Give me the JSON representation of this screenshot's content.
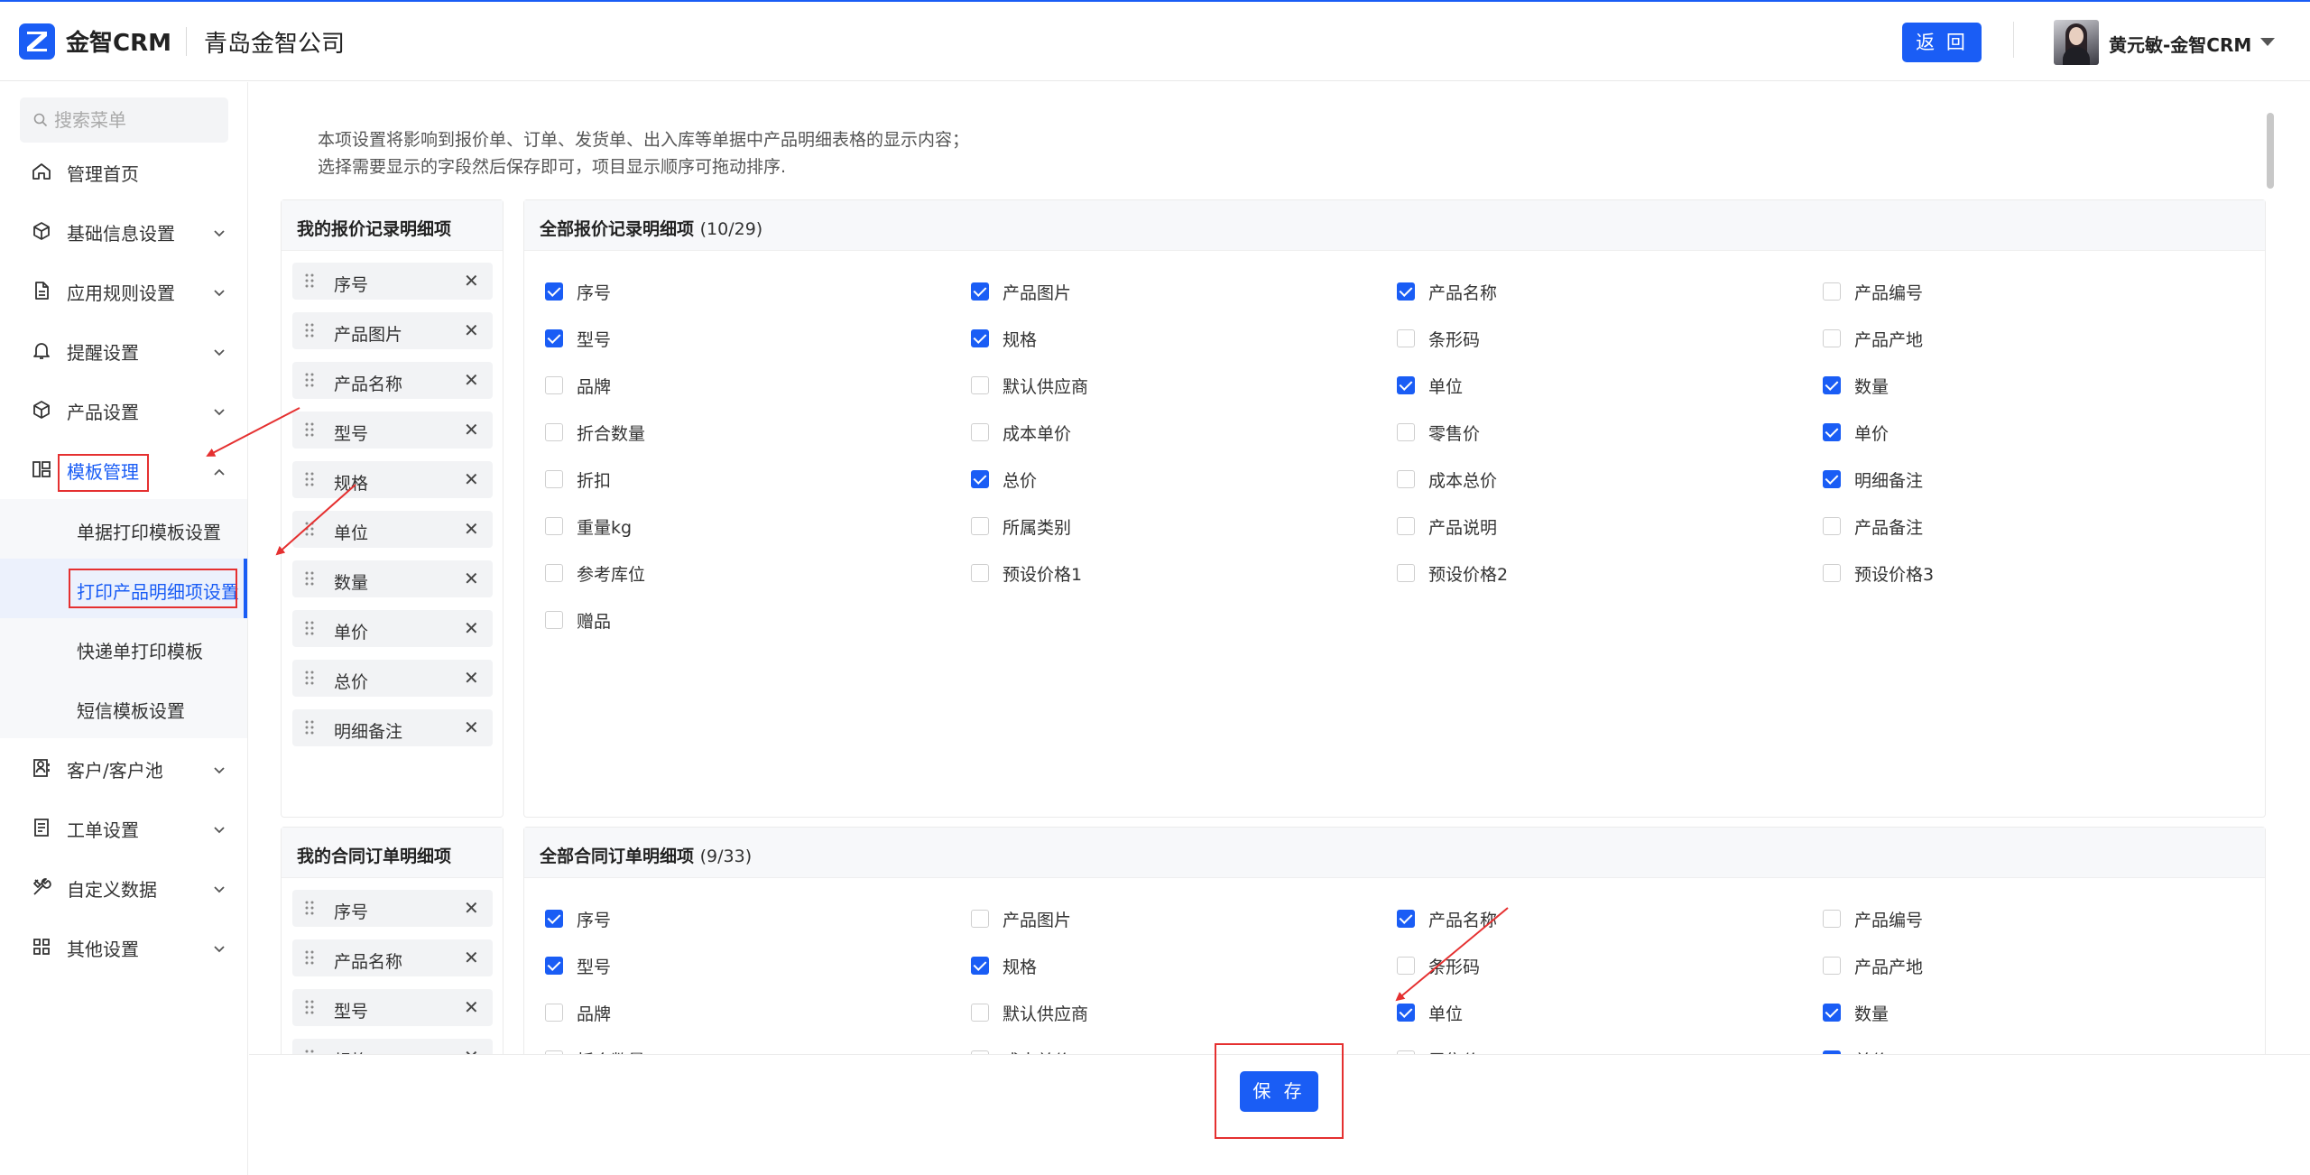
{
  "header": {
    "brand": "金智CRM",
    "company": "青岛金智公司",
    "back_label": "返 回",
    "username": "黄元敏-金智CRM"
  },
  "sidebar": {
    "search_placeholder": "搜索菜单",
    "items": [
      {
        "label": "管理首页",
        "icon": "home-icon"
      },
      {
        "label": "基础信息设置",
        "icon": "cube-icon"
      },
      {
        "label": "应用规则设置",
        "icon": "document-icon"
      },
      {
        "label": "提醒设置",
        "icon": "bell-icon"
      },
      {
        "label": "产品设置",
        "icon": "box-icon"
      },
      {
        "label": "模板管理",
        "icon": "template-icon"
      },
      {
        "label": "客户/客户池",
        "icon": "contacts-icon"
      },
      {
        "label": "工单设置",
        "icon": "workorder-icon"
      },
      {
        "label": "自定义数据",
        "icon": "tools-icon"
      },
      {
        "label": "其他设置",
        "icon": "grid-icon"
      }
    ],
    "sub_items": [
      {
        "label": "单据打印模板设置"
      },
      {
        "label": "打印产品明细项设置"
      },
      {
        "label": "快递单打印模板"
      },
      {
        "label": "短信模板设置"
      }
    ]
  },
  "main": {
    "note_line1": "本项设置将影响到报价单、订单、发货单、出入库等单据中产品明细表格的显示内容；",
    "note_line2": "选择需要显示的字段然后保存即可，项目显示顺序可拖动排序.",
    "quote_mine_title": "我的报价记录明细项",
    "quote_mine_items": [
      "序号",
      "产品图片",
      "产品名称",
      "型号",
      "规格",
      "单位",
      "数量",
      "单价",
      "总价",
      "明细备注"
    ],
    "quote_all_title": "全部报价记录明细项",
    "quote_all_count": "(10/29)",
    "quote_all_options": [
      {
        "label": "序号",
        "checked": true
      },
      {
        "label": "产品图片",
        "checked": true
      },
      {
        "label": "产品名称",
        "checked": true
      },
      {
        "label": "产品编号",
        "checked": false
      },
      {
        "label": "型号",
        "checked": true
      },
      {
        "label": "规格",
        "checked": true
      },
      {
        "label": "条形码",
        "checked": false
      },
      {
        "label": "产品产地",
        "checked": false
      },
      {
        "label": "品牌",
        "checked": false
      },
      {
        "label": "默认供应商",
        "checked": false
      },
      {
        "label": "单位",
        "checked": true
      },
      {
        "label": "数量",
        "checked": true
      },
      {
        "label": "折合数量",
        "checked": false
      },
      {
        "label": "成本单价",
        "checked": false
      },
      {
        "label": "零售价",
        "checked": false
      },
      {
        "label": "单价",
        "checked": true
      },
      {
        "label": "折扣",
        "checked": false
      },
      {
        "label": "总价",
        "checked": true
      },
      {
        "label": "成本总价",
        "checked": false
      },
      {
        "label": "明细备注",
        "checked": true
      },
      {
        "label": "重量kg",
        "checked": false
      },
      {
        "label": "所属类别",
        "checked": false
      },
      {
        "label": "产品说明",
        "checked": false
      },
      {
        "label": "产品备注",
        "checked": false
      },
      {
        "label": "参考库位",
        "checked": false
      },
      {
        "label": "预设价格1",
        "checked": false
      },
      {
        "label": "预设价格2",
        "checked": false
      },
      {
        "label": "预设价格3",
        "checked": false
      },
      {
        "label": "赠品",
        "checked": false
      }
    ],
    "contract_mine_title": "我的合同订单明细项",
    "contract_mine_items": [
      "序号",
      "产品名称",
      "型号",
      "规格"
    ],
    "contract_all_title": "全部合同订单明细项",
    "contract_all_count": "(9/33)",
    "contract_all_options": [
      {
        "label": "序号",
        "checked": true
      },
      {
        "label": "产品图片",
        "checked": false
      },
      {
        "label": "产品名称",
        "checked": true
      },
      {
        "label": "产品编号",
        "checked": false
      },
      {
        "label": "型号",
        "checked": true
      },
      {
        "label": "规格",
        "checked": true
      },
      {
        "label": "条形码",
        "checked": false
      },
      {
        "label": "产品产地",
        "checked": false
      },
      {
        "label": "品牌",
        "checked": false
      },
      {
        "label": "默认供应商",
        "checked": false
      },
      {
        "label": "单位",
        "checked": true
      },
      {
        "label": "数量",
        "checked": true
      },
      {
        "label": "折合数量",
        "checked": false
      },
      {
        "label": "成本单价",
        "checked": false
      },
      {
        "label": "零售价",
        "checked": false
      },
      {
        "label": "单价",
        "checked": true
      }
    ],
    "save_label": "保 存"
  },
  "colors": {
    "accent": "#1a5df5",
    "annotation_red": "#e53030"
  }
}
